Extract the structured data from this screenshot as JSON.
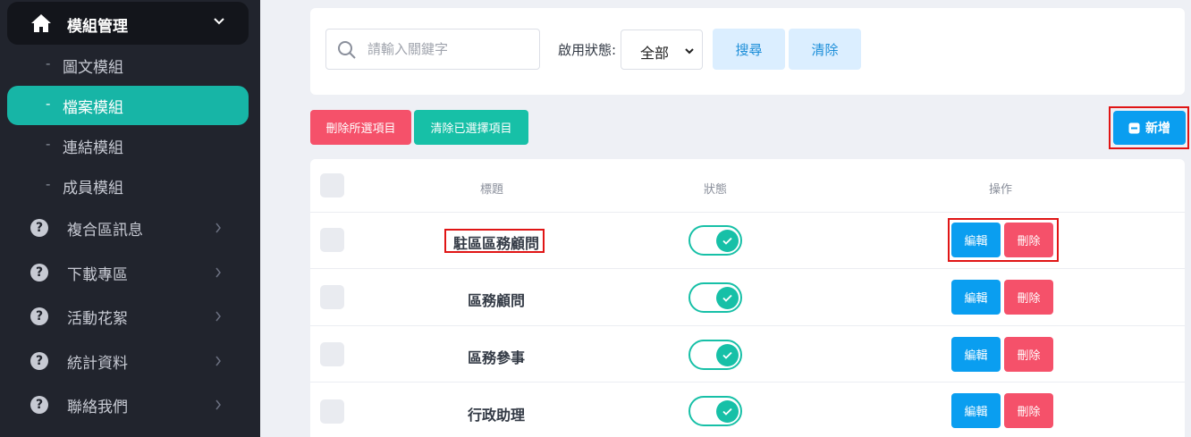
{
  "sidebar": {
    "active_parent": {
      "label": "模組管理",
      "icon": "home-icon"
    },
    "subitems": [
      {
        "label": "圖文模組",
        "active": false
      },
      {
        "label": "檔案模組",
        "active": true
      },
      {
        "label": "連結模組",
        "active": false
      },
      {
        "label": "成員模組",
        "active": false
      }
    ],
    "dash": "-",
    "items": [
      {
        "label": "複合區訊息",
        "icon": "question-circle-icon"
      },
      {
        "label": "下載專區",
        "icon": "question-circle-icon"
      },
      {
        "label": "活動花絮",
        "icon": "question-circle-icon"
      },
      {
        "label": "統計資料",
        "icon": "question-circle-icon"
      },
      {
        "label": "聯絡我們",
        "icon": "question-circle-icon"
      }
    ],
    "question_glyph": "?"
  },
  "search": {
    "placeholder": "請輸入關鍵字",
    "value": "",
    "status_label": "啟用狀態:",
    "status_value": "全部",
    "search_label": "搜尋",
    "clear_label": "清除"
  },
  "actions": {
    "delete_selected": "刪除所選項目",
    "clear_selected": "清除已選擇項目",
    "add": "新增"
  },
  "table": {
    "headers": {
      "title": "標題",
      "status": "狀態",
      "actions": "操作"
    },
    "rows": [
      {
        "title": "駐區區務顧問",
        "enabled": true,
        "edit": "編輯",
        "delete": "刪除"
      },
      {
        "title": "區務顧問",
        "enabled": true,
        "edit": "編輯",
        "delete": "刪除"
      },
      {
        "title": "區務參事",
        "enabled": true,
        "edit": "編輯",
        "delete": "刪除"
      },
      {
        "title": "行政助理",
        "enabled": true,
        "edit": "編輯",
        "delete": "刪除"
      }
    ]
  },
  "colors": {
    "sidebar_bg": "#21242d",
    "accent_teal": "#17c0a7",
    "primary_blue": "#0a9ef0",
    "danger_red": "#f5516a",
    "highlight_red": "#e01515"
  }
}
